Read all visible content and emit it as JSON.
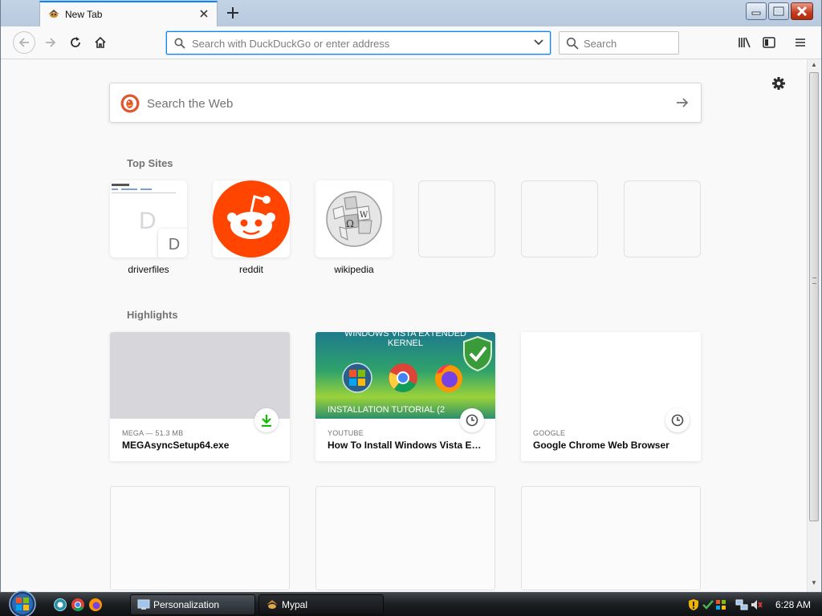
{
  "browser": {
    "tab": {
      "title": "New Tab"
    },
    "url": {
      "placeholder": "Search with DuckDuckGo or enter address"
    },
    "search": {
      "placeholder": "Search"
    }
  },
  "newtab": {
    "web_search_placeholder": "Search the Web",
    "top_sites_title": "Top Sites",
    "top_sites": [
      {
        "label": "driverfiles",
        "initial": "D"
      },
      {
        "label": "reddit"
      },
      {
        "label": "wikipedia"
      },
      {
        "label": ""
      },
      {
        "label": ""
      },
      {
        "label": ""
      }
    ],
    "highlights_title": "Highlights",
    "highlights": [
      {
        "context": "MEGA — 51.3 MB",
        "title": "MEGAsyncSetup64.exe",
        "badge": "download-icon"
      },
      {
        "context": "YouTube",
        "title": "How To Install Windows Vista Ex...",
        "badge": "clock-icon",
        "thumb_top_text": "WINDOWS VISTA EXTENDED",
        "thumb_top_text2": "KERNEL",
        "thumb_bottom_text": "INSTALLATION TUTORIAL (2"
      },
      {
        "context": "Google",
        "title": "Google Chrome Web Browser",
        "badge": "clock-icon"
      }
    ]
  },
  "taskbar": {
    "tasks": [
      {
        "label": "Personalization"
      },
      {
        "label": "Mypal"
      }
    ],
    "clock": "6:28 AM"
  },
  "colors": {
    "accent": "#0a84ff",
    "reddit": "#ff4500",
    "download": "#12bc00"
  }
}
